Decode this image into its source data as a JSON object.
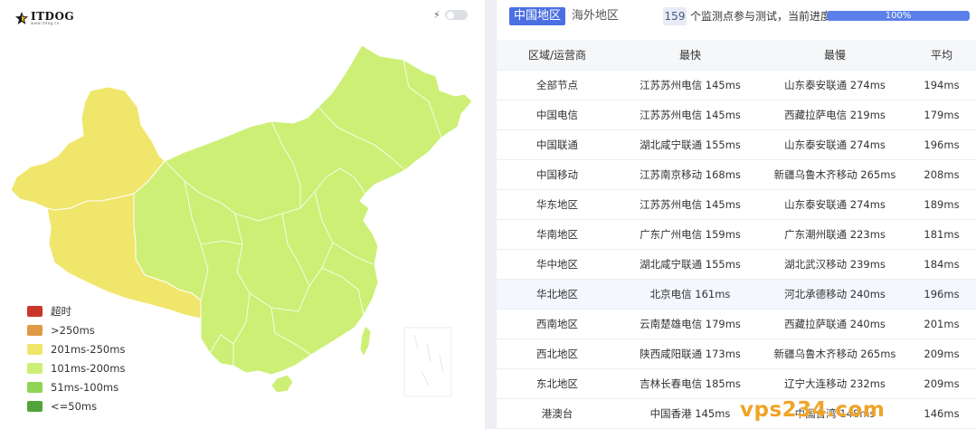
{
  "logo": {
    "text": "ITDOG",
    "sub": "www.itdog.cn"
  },
  "map_toggle": {
    "icon": "bolt-icon",
    "state": "off"
  },
  "legend": [
    {
      "label": "超时",
      "color": "#c9372c"
    },
    {
      "label": ">250ms",
      "color": "#e09a44"
    },
    {
      "label": "201ms-250ms",
      "color": "#f1e66c"
    },
    {
      "label": "101ms-200ms",
      "color": "#cdef76"
    },
    {
      "label": "51ms-100ms",
      "color": "#8ed553"
    },
    {
      "label": "<=50ms",
      "color": "#52a43a"
    }
  ],
  "tabs": [
    {
      "label": "中国地区",
      "active": true
    },
    {
      "label": "海外地区",
      "active": false
    }
  ],
  "status": {
    "count": "159",
    "text": "个监测点参与测试，当前进度：",
    "progress": 100,
    "progress_label": "100%"
  },
  "table": {
    "columns": [
      "区域/运营商",
      "最快",
      "最慢",
      "平均"
    ],
    "rows": [
      [
        "全部节点",
        "江苏苏州电信 145ms",
        "山东泰安联通 274ms",
        "194ms"
      ],
      [
        "中国电信",
        "江苏苏州电信 145ms",
        "西藏拉萨电信 219ms",
        "179ms"
      ],
      [
        "中国联通",
        "湖北咸宁联通 155ms",
        "山东泰安联通 274ms",
        "196ms"
      ],
      [
        "中国移动",
        "江苏南京移动 168ms",
        "新疆乌鲁木齐移动 265ms",
        "208ms"
      ],
      [
        "华东地区",
        "江苏苏州电信 145ms",
        "山东泰安联通 274ms",
        "189ms"
      ],
      [
        "华南地区",
        "广东广州电信 159ms",
        "广东潮州联通 223ms",
        "181ms"
      ],
      [
        "华中地区",
        "湖北咸宁联通 155ms",
        "湖北武汉移动 239ms",
        "184ms"
      ],
      [
        "华北地区",
        "北京电信 161ms",
        "河北承德移动 240ms",
        "196ms"
      ],
      [
        "西南地区",
        "云南楚雄电信 179ms",
        "西藏拉萨联通 240ms",
        "201ms"
      ],
      [
        "西北地区",
        "陕西咸阳联通 173ms",
        "新疆乌鲁木齐移动 265ms",
        "209ms"
      ],
      [
        "东北地区",
        "吉林长春电信 185ms",
        "辽宁大连移动 232ms",
        "209ms"
      ],
      [
        "港澳台",
        "中国香港 145ms",
        "中国台湾 148ms",
        "146ms"
      ]
    ],
    "highlighted_row": 7
  },
  "map_colors": {
    "west": "#f1e66c",
    "east": "#cdef76",
    "border": "#ffffff"
  },
  "watermark": "vps234.com"
}
